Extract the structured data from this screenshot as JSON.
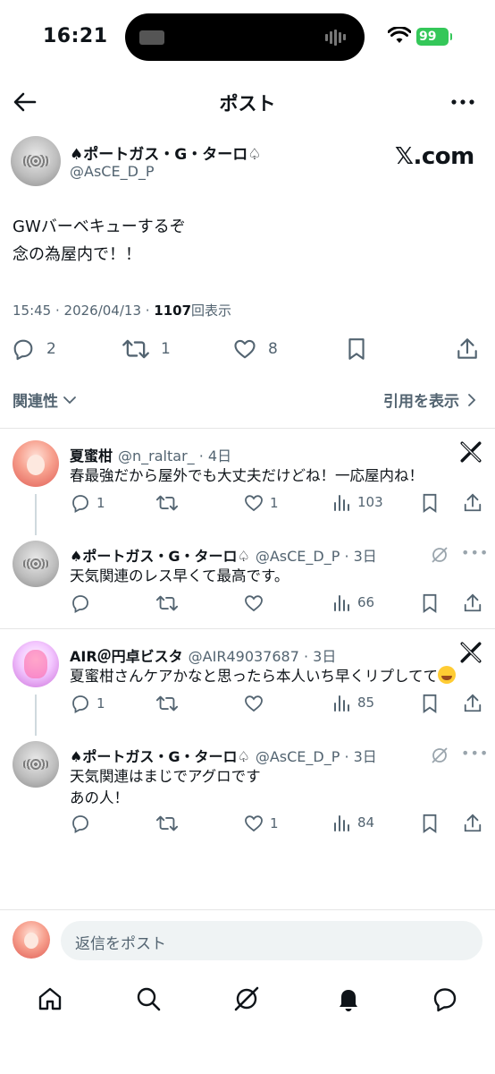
{
  "status_bar": {
    "time": "16:21",
    "battery": "99"
  },
  "nav": {
    "title": "ポスト"
  },
  "main_post": {
    "name": "♠ポートガス・G・ターロ♤",
    "handle": "@AsCE_D_P",
    "watermark": "𝕏.com",
    "text": "GWバーベキューするぞ\n念の為屋内で！！",
    "time": "15:45 · 2026/04/13 · ",
    "views": "1107",
    "views_label": "回表示",
    "replies": "2",
    "reposts": "1",
    "likes": "8",
    "sort_label": "関連性",
    "quotes_label": "引用を表示"
  },
  "replies": [
    {
      "name": "夏蜜柑",
      "handle": "@n_raltar_",
      "time": "· 4日",
      "text": "春最強だから屋外でも大丈夫だけどね！一応屋内ね！",
      "replies": "1",
      "reposts": "",
      "likes": "1",
      "views": "103"
    },
    {
      "name": "♠ポートガス・G・ターロ♤",
      "handle": "@AsCE_D_P",
      "time": "· 3日",
      "text": "天気関連のレス早くて最高です。",
      "replies": "",
      "reposts": "",
      "likes": "",
      "views": "66"
    },
    {
      "name": "AIR＠円卓ビスタ",
      "handle": "@AIR49037687",
      "time": "· 3日",
      "text": "夏蜜柑さんケアかなと思ったら本人いち早くリプしてて",
      "emoji": "joy-emoji",
      "replies": "1",
      "reposts": "",
      "likes": "",
      "views": "85"
    },
    {
      "name": "♠ポートガス・G・ターロ♤",
      "handle": "@AsCE_D_P",
      "time": "· 3日",
      "text": "天気関連はまじでアグロです\nあの人！",
      "replies": "",
      "reposts": "",
      "likes": "1",
      "views": "84"
    }
  ],
  "compose": {
    "placeholder": "返信をポスト"
  },
  "tabbar": [
    "home-icon",
    "search-icon",
    "grok-icon",
    "notifications-icon",
    "messages-icon"
  ],
  "colors": {
    "text": "#0f1419",
    "secondary": "#536471",
    "battery": "#34c759",
    "input_bg": "#eff3f4"
  }
}
